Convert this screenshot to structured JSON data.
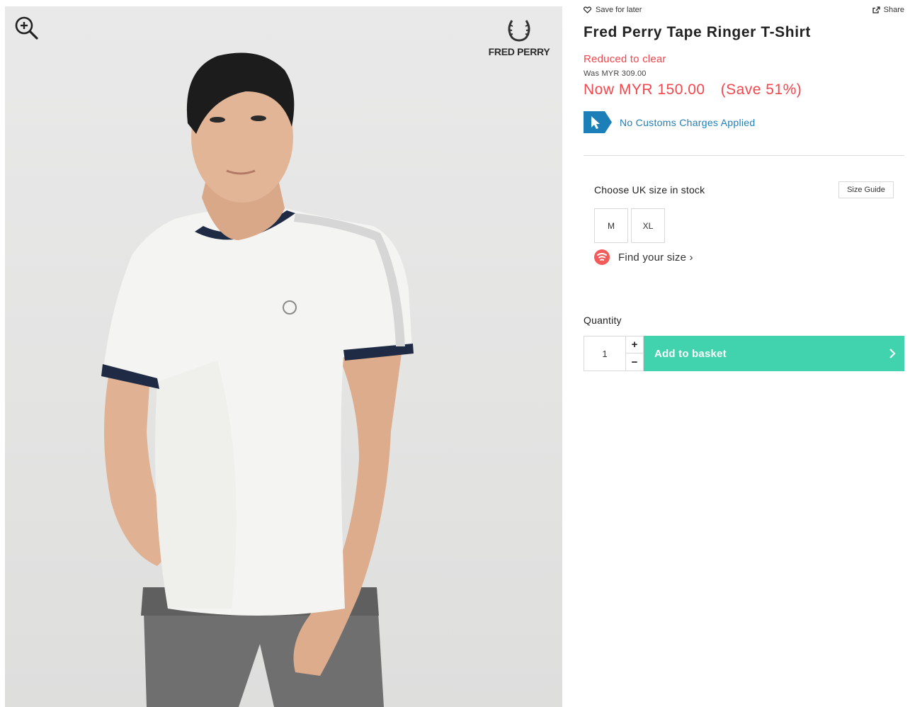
{
  "product": {
    "brand": "FRED PERRY",
    "title": "Fred Perry Tape Ringer T-Shirt",
    "sale_label": "Reduced to clear",
    "was_price": "Was MYR 309.00",
    "now_price": "Now MYR 150.00",
    "save_percent": "(Save 51%)"
  },
  "actions": {
    "save_for_later": "Save for later",
    "share": "Share"
  },
  "customs": {
    "text": "No Customs Charges Applied"
  },
  "size": {
    "heading": "Choose UK size in stock",
    "guide_label": "Size Guide",
    "options": [
      "M",
      "XL"
    ],
    "find_size": "Find your size ›"
  },
  "quantity": {
    "label": "Quantity",
    "value": "1",
    "plus": "+",
    "minus": "−"
  },
  "basket": {
    "label": "Add to basket"
  },
  "colors": {
    "sale_red": "#f2474d",
    "customs_blue": "#1d7fb8",
    "basket_green": "#40d3ad",
    "shirt_white": "#f4f4f2",
    "tipping_navy": "#1f2a44"
  },
  "icons": {
    "zoom": "zoom-in-icon",
    "save": "heart-icon",
    "share": "share-icon",
    "customs": "cursor-arrow-badge-icon",
    "find_size": "fit-finder-icon",
    "basket": "chevron-right-icon"
  }
}
